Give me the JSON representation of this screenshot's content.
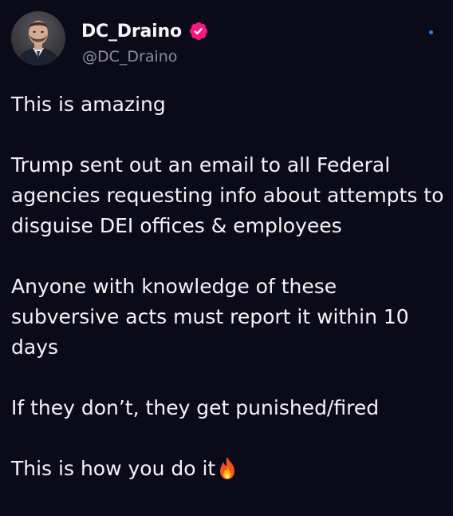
{
  "author": {
    "display_name": "DC_Draino",
    "handle": "@DC_Draino",
    "verified": true,
    "verified_badge_color": "#f91880",
    "avatar": "avatar-photo"
  },
  "more_menu": {
    "icon": "more-dot-icon",
    "color": "#2c7fe0"
  },
  "tweet": {
    "paragraphs": [
      "This is amazing",
      "Trump sent out an email to all Federal agencies requesting info about attempts to disguise DEI offices & employees",
      "Anyone with knowledge of these subversive acts must report it within 10 days",
      "If they don’t, they get punished/fired",
      "This is how you do it"
    ],
    "trailing_emoji": "fire-emoji"
  },
  "colors": {
    "background": "#0b0a19",
    "text": "#f4f4f6",
    "secondary_text": "#8e8d9c"
  }
}
